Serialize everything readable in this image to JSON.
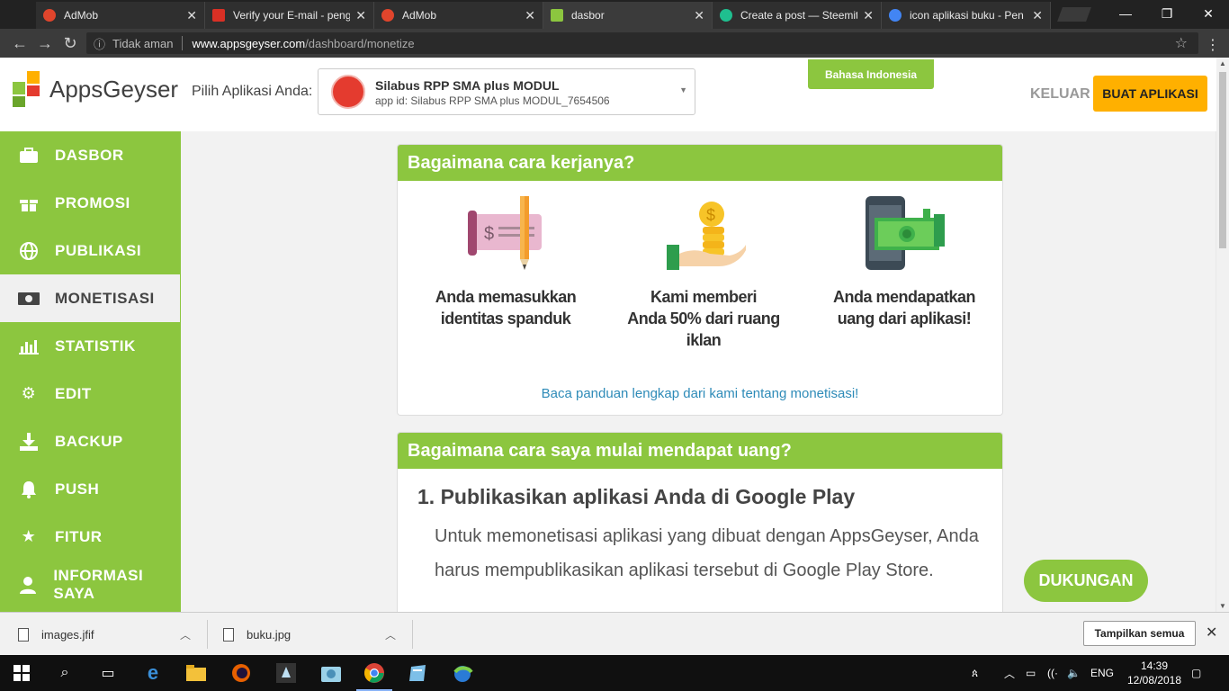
{
  "browser": {
    "tabs": [
      {
        "title": "AdMob",
        "favicon_color": "#e0452c"
      },
      {
        "title": "Verify your E-mail - peng",
        "favicon_color": "#d93025"
      },
      {
        "title": "AdMob",
        "favicon_color": "#e0452c"
      },
      {
        "title": "dasbor",
        "favicon_color": "#8cc63f"
      },
      {
        "title": "Create a post — Steemit",
        "favicon_color": "#1fbf8f"
      },
      {
        "title": "icon aplikasi buku - Pen",
        "favicon_color": "#4285f4"
      }
    ],
    "address": {
      "security": "Tidak aman",
      "host": "www.appsgeyser.com",
      "path": "/dashboard/monetize"
    }
  },
  "header": {
    "brand": "AppsGeyser",
    "pick_label": "Pilih Aplikasi Anda:",
    "app_name": "Silabus RPP SMA plus MODUL",
    "app_id": "app id: Silabus RPP SMA plus MODUL_7654506",
    "language": "Bahasa Indonesia",
    "logout": "KELUAR",
    "create_app": "BUAT APLIKASI"
  },
  "sidebar": {
    "items": [
      {
        "label": "DASBOR",
        "icon": "briefcase-icon"
      },
      {
        "label": "PROMOSI",
        "icon": "gift-icon"
      },
      {
        "label": "PUBLIKASI",
        "icon": "globe-icon"
      },
      {
        "label": "MONETISASI",
        "icon": "money-icon",
        "active": true
      },
      {
        "label": "STATISTIK",
        "icon": "bar-chart-icon"
      },
      {
        "label": "EDIT",
        "icon": "gears-icon"
      },
      {
        "label": "BACKUP",
        "icon": "download-icon"
      },
      {
        "label": "PUSH",
        "icon": "bell-icon"
      },
      {
        "label": "FITUR",
        "icon": "star-icon"
      },
      {
        "label": "INFORMASI SAYA",
        "icon": "user-icon"
      }
    ]
  },
  "how_it_works": {
    "title": "Bagaimana cara kerjanya?",
    "step1": "Anda memasukkan identitas spanduk",
    "step2a": "Kami memberi",
    "step2b": "Anda 50% dari ruang iklan",
    "step3": "Anda mendapatkan uang dari aplikasi!",
    "guide_link": "Baca panduan lengkap dari kami tentang monetisasi!"
  },
  "start_earning": {
    "title": "Bagaimana cara saya mulai mendapat uang?",
    "step_heading": "1. Publikasikan aplikasi Anda di Google Play",
    "step_text": "Untuk memonetisasi aplikasi yang dibuat dengan AppsGeyser, Anda harus mempublikasikan aplikasi tersebut di Google Play Store."
  },
  "support_button": "DUKUNGAN",
  "downloads": {
    "items": [
      "images.jfif",
      "buku.jpg"
    ],
    "show_all": "Tampilkan semua"
  },
  "taskbar": {
    "language": "ENG",
    "time": "14:39",
    "date": "12/08/2018"
  },
  "colors": {
    "accent": "#8cc63f",
    "cta": "#ffb000",
    "link": "#2e8bb8"
  }
}
